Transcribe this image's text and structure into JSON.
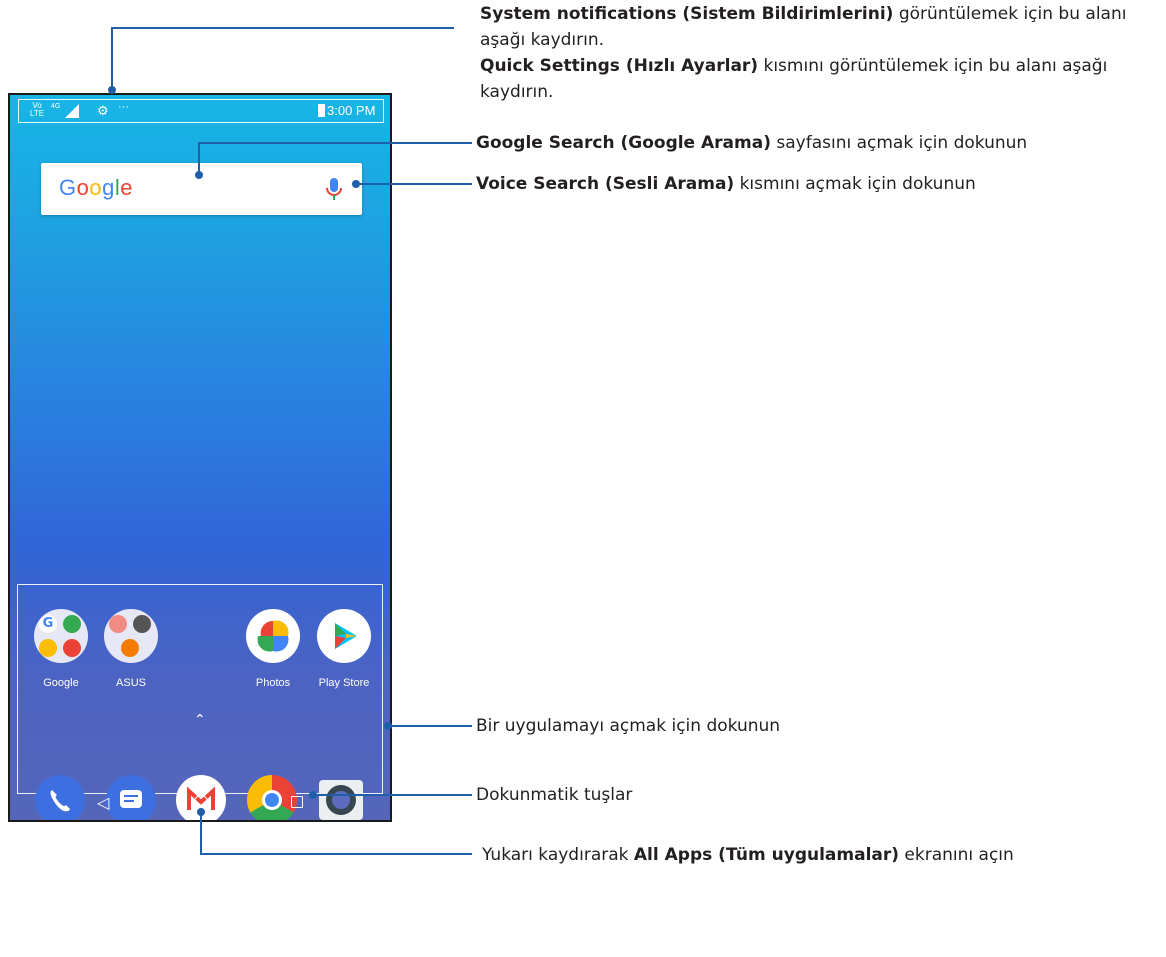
{
  "status_bar": {
    "volte": "VoLTE",
    "network": "4G",
    "time": "3:00 PM"
  },
  "search": {
    "logo": "Google"
  },
  "apps": [
    {
      "label": "Google",
      "icon": "google-folder-icon"
    },
    {
      "label": "ASUS",
      "icon": "asus-folder-icon"
    },
    {
      "label": "Photos",
      "icon": "photos-icon"
    },
    {
      "label": "Play Store",
      "icon": "play-store-icon"
    }
  ],
  "dock": [
    {
      "icon": "phone-icon"
    },
    {
      "icon": "messages-icon"
    },
    {
      "icon": "gmail-icon"
    },
    {
      "icon": "chrome-icon"
    },
    {
      "icon": "camera-icon"
    }
  ],
  "callouts": {
    "notifications": {
      "bold1": "System notifications (Sistem Bildirimlerini)",
      "text1": " görüntülemek için bu alanı aşağı kaydırın.",
      "bold2": "Quick Settings (Hızlı Ayarlar)",
      "text2": " kısmını görüntülemek için bu alanı aşağı kaydırın."
    },
    "google_search": {
      "bold": "Google Search (Google Arama)",
      "text": " sayfasını açmak için dokunun"
    },
    "voice_search": {
      "bold": "Voice Search (Sesli Arama)",
      "text": " kısmını açmak için dokunun"
    },
    "apps": {
      "text": "Bir uygulamayı açmak için dokunun"
    },
    "touch_keys": {
      "text": "Dokunmatik tuşlar"
    },
    "all_apps": {
      "text1": "Yukarı kaydırarak ",
      "bold": "All Apps (Tüm uygulamalar)",
      "text2": " ekranını açın"
    }
  },
  "colors": {
    "callout_line": "#1f5fa8",
    "google_blue": "#4285f4"
  }
}
